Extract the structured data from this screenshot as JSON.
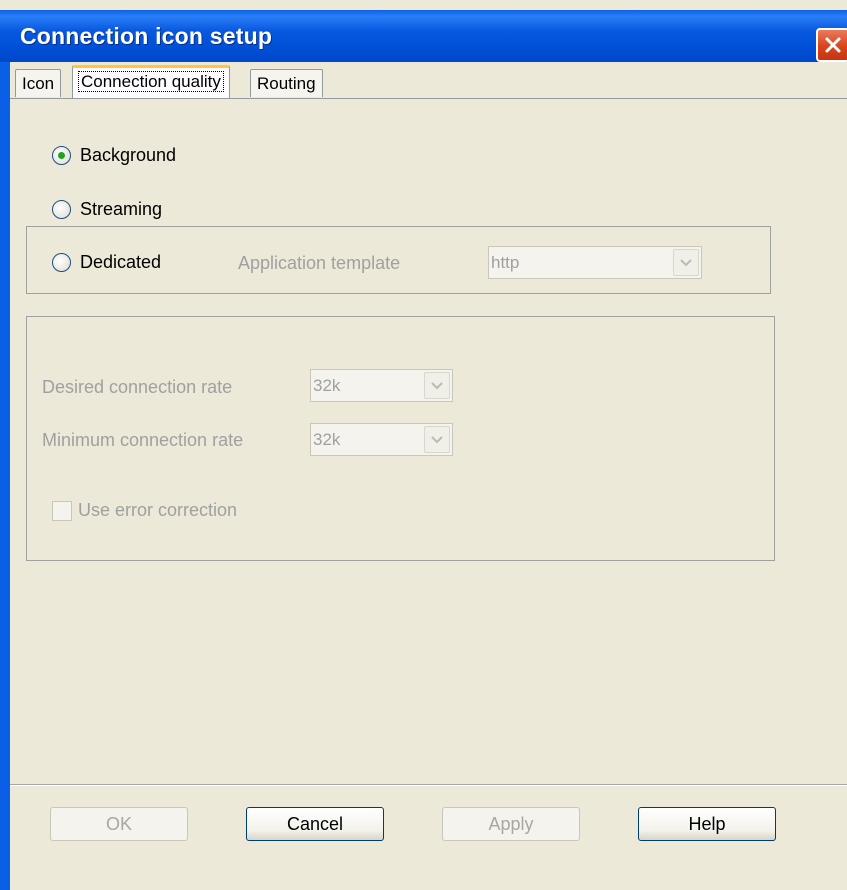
{
  "window": {
    "title": "Connection icon setup"
  },
  "tabs": [
    {
      "label": "Icon",
      "active": false
    },
    {
      "label": "Connection quality",
      "active": true
    },
    {
      "label": "Routing",
      "active": false
    }
  ],
  "connection_type": {
    "options": [
      {
        "label": "Background",
        "selected": true
      },
      {
        "label": "Streaming",
        "selected": false
      },
      {
        "label": "Dedicated",
        "selected": false
      }
    ],
    "application_template": {
      "label": "Application template",
      "value": "http",
      "enabled": false
    }
  },
  "rates": {
    "desired": {
      "label": "Desired connection rate",
      "value": "32k",
      "enabled": false
    },
    "minimum": {
      "label": "Minimum connection rate",
      "value": "32k",
      "enabled": false
    },
    "error_correction": {
      "label": "Use error correction",
      "checked": false,
      "enabled": false
    }
  },
  "buttons": {
    "ok": {
      "label": "OK",
      "enabled": false
    },
    "cancel": {
      "label": "Cancel",
      "enabled": true
    },
    "apply": {
      "label": "Apply",
      "enabled": false
    },
    "help": {
      "label": "Help",
      "enabled": true
    }
  },
  "colors": {
    "titlebar": "#0a5fe6",
    "dialog_bg": "#ece9d8",
    "selected_radio_dot": "#21a121",
    "active_tab_accent": "#ffc83c",
    "close_button": "#d9441c"
  }
}
